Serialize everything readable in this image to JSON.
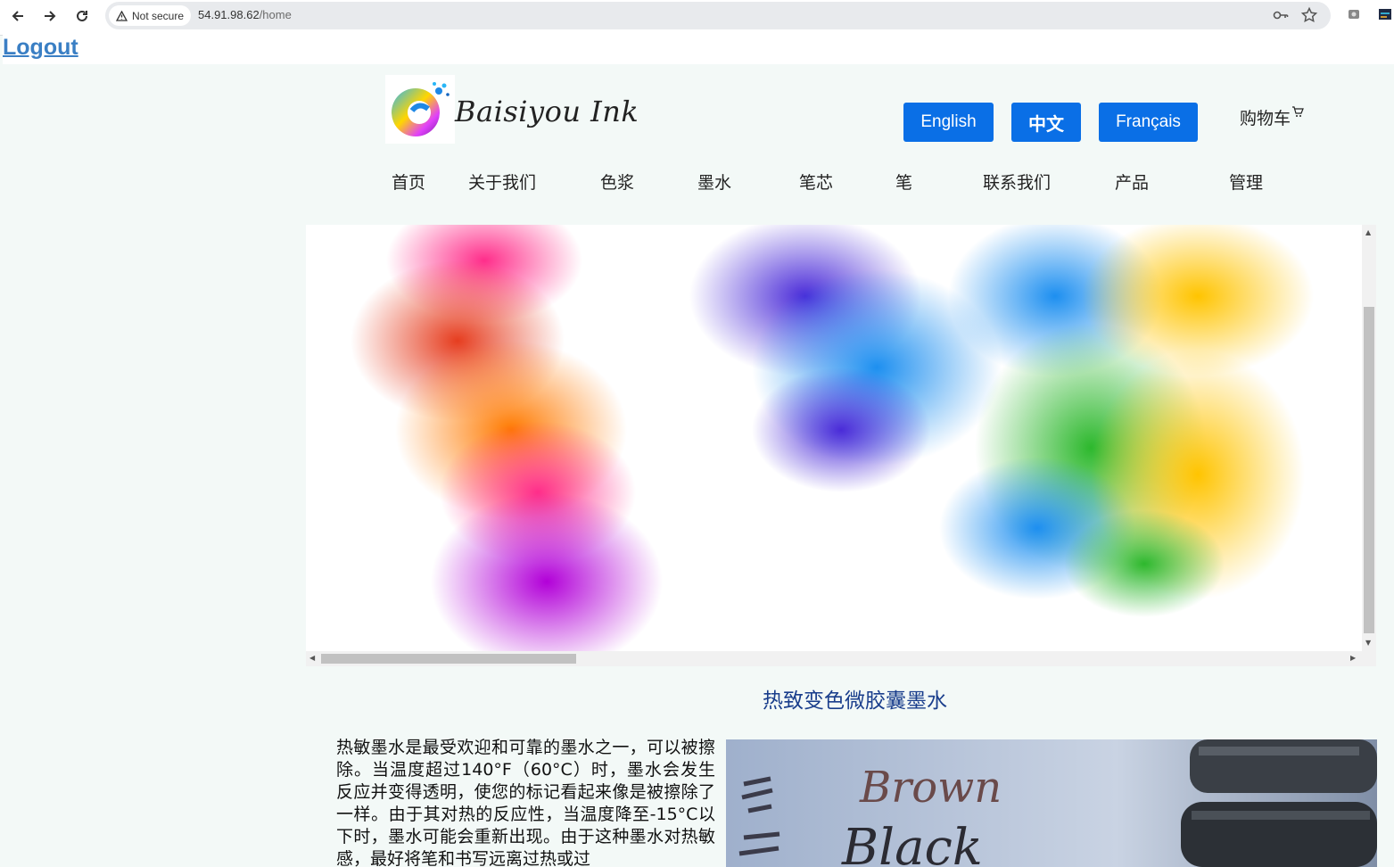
{
  "browser": {
    "security_label": "Not secure",
    "url_host": "54.91.98.62",
    "url_path": "/home",
    "back_icon": "arrow-left-icon",
    "forward_icon": "arrow-right-icon",
    "reload_icon": "reload-icon",
    "key_icon": "key-icon",
    "star_icon": "star-icon"
  },
  "page": {
    "logout_label": "Logout",
    "brand_name": "Baisiyou Ink",
    "languages": [
      "English",
      "中文",
      "Français"
    ],
    "cart_label": "购物车",
    "menu": [
      "首页",
      "关于我们",
      "色浆",
      "墨水",
      "笔芯",
      "笔",
      "联系我们",
      "产品",
      "管理"
    ],
    "section_title": "热致变色微胶囊墨水",
    "description": "热敏墨水是最受欢迎和可靠的墨水之一，可以被擦除。当温度超过140°F（60°C）时，墨水会发生反应并变得透明，使您的标记看起来像是被擦除了一样。由于其对热的反应性，当温度降至-15°C以下时，墨水可能会重新出现。由于这种墨水对热敏感，最好将笔和书写远离过热或过",
    "photo_words": [
      "Brown",
      "Black"
    ],
    "colors": {
      "button_blue": "#0a6fe6",
      "title_blue": "#1a3e8c",
      "logout_blue": "#3a7fc4",
      "page_bg": "#f3f9f7"
    }
  }
}
